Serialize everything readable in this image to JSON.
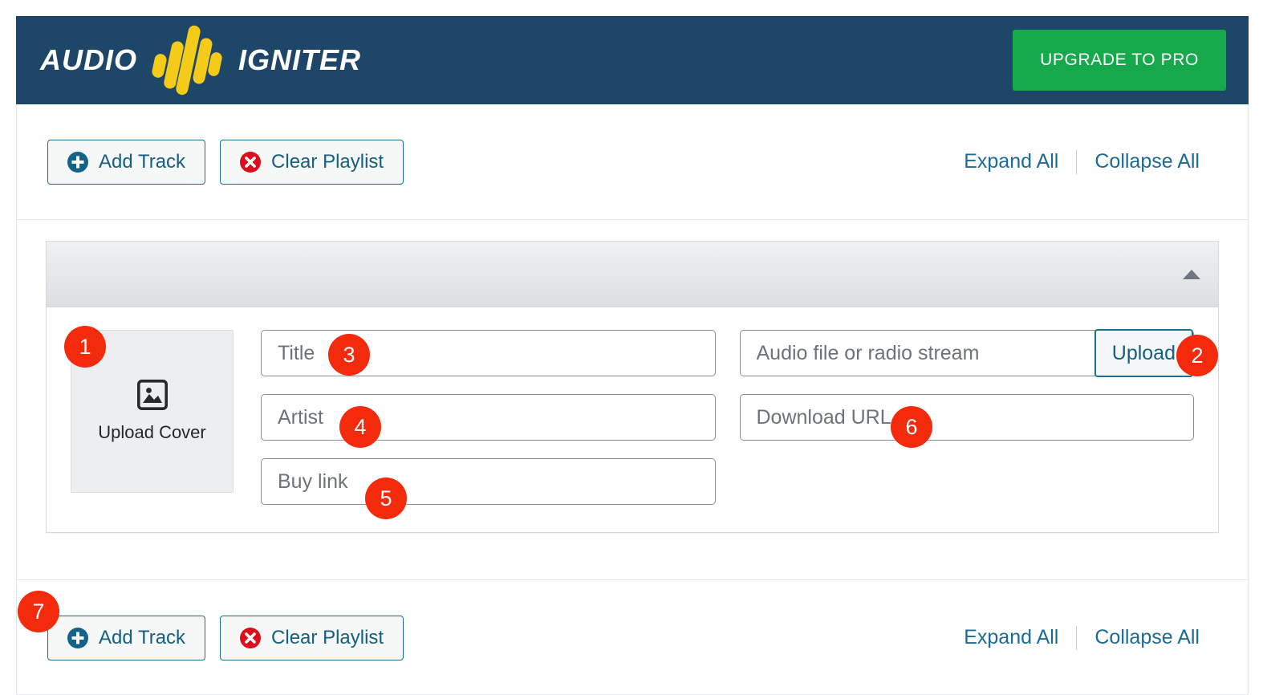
{
  "header": {
    "brand_left": "AUDIO",
    "brand_right": "IGNITER",
    "logo_icon": "waveform-icon",
    "upgrade_label": "UPGRADE TO PRO",
    "bg_color": "#1d4668",
    "upgrade_color": "#16a94b",
    "logo_color": "#f5cb1a"
  },
  "toolbar_top": {
    "add_track_label": "Add Track",
    "add_track_icon": "plus-circle-icon",
    "clear_playlist_label": "Clear Playlist",
    "clear_playlist_icon": "x-circle-icon",
    "expand_all_label": "Expand All",
    "collapse_all_label": "Collapse All"
  },
  "toolbar_bottom": {
    "add_track_label": "Add Track",
    "add_track_icon": "plus-circle-icon",
    "clear_playlist_label": "Clear Playlist",
    "clear_playlist_icon": "x-circle-icon",
    "expand_all_label": "Expand All",
    "collapse_all_label": "Collapse All"
  },
  "track": {
    "collapse_icon": "caret-up-icon",
    "cover": {
      "icon": "image-placeholder-icon",
      "label": "Upload Cover"
    },
    "fields": {
      "title_placeholder": "Title",
      "title_value": "",
      "artist_placeholder": "Artist",
      "artist_value": "",
      "buy_link_placeholder": "Buy link",
      "buy_link_value": "",
      "audio_placeholder": "Audio file or radio stream",
      "audio_value": "",
      "upload_label": "Upload",
      "download_url_placeholder": "Download URL",
      "download_url_value": ""
    }
  },
  "badges": {
    "color": "#f32a0b",
    "b1": "1",
    "b2": "2",
    "b3": "3",
    "b4": "4",
    "b5": "5",
    "b6": "6",
    "b7": "7"
  }
}
